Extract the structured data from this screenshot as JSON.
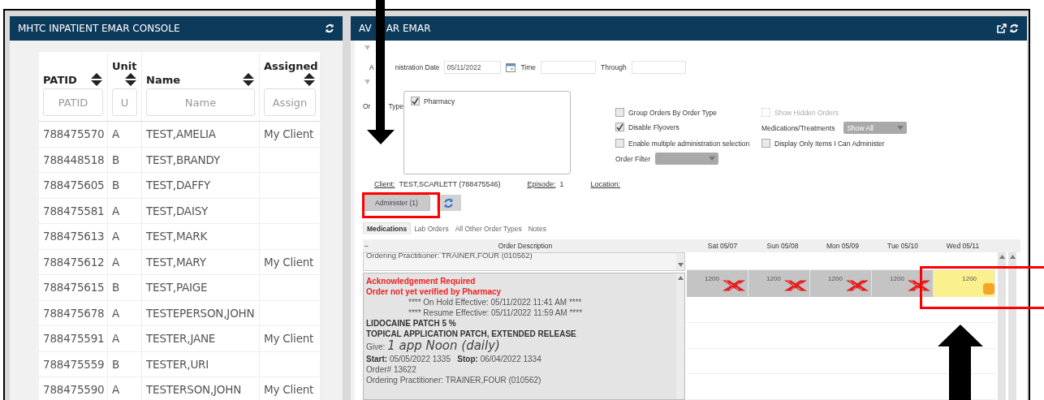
{
  "console_panel": {
    "title": "MHTC INPATIENT EMAR CONSOLE",
    "table": {
      "columns": [
        {
          "label": "PATID",
          "filter_placeholder": "PATID"
        },
        {
          "label": "Unit",
          "filter_placeholder": "U"
        },
        {
          "label": "Name",
          "filter_placeholder": "Name"
        },
        {
          "label": "Assigned",
          "filter_placeholder": "Assign"
        }
      ],
      "rows": [
        [
          "788475570",
          "A",
          "TEST,AMELIA",
          "My Client"
        ],
        [
          "788448518",
          "B",
          "TEST,BRANDY",
          ""
        ],
        [
          "788475605",
          "B",
          "TEST,DAFFY",
          ""
        ],
        [
          "788475581",
          "A",
          "TEST,DAISY",
          ""
        ],
        [
          "788475613",
          "A",
          "TEST,MARK",
          ""
        ],
        [
          "788475612",
          "A",
          "TEST,MARY",
          "My Client"
        ],
        [
          "788475615",
          "B",
          "TEST,PAIGE",
          ""
        ],
        [
          "788475678",
          "A",
          "TESTEPERSON,JOHN",
          ""
        ],
        [
          "788475591",
          "A",
          "TESTER,JANE",
          "My Client"
        ],
        [
          "788475559",
          "B",
          "TESTER,URI",
          ""
        ],
        [
          "788475590",
          "A",
          "TESTERSON,JOHN",
          "My Client"
        ]
      ]
    }
  },
  "emar_panel": {
    "title_parts": [
      "AV",
      "AR EMAR"
    ],
    "filters": {
      "date_label_parts": [
        "A",
        "nistration Date"
      ],
      "date_value": "05/11/2022",
      "time_label": "Time",
      "through_label": "Through",
      "order_type_label_parts": [
        "Or",
        "Type"
      ],
      "order_types": [
        {
          "label": "Pharmacy",
          "checked": true
        }
      ]
    },
    "options": [
      {
        "kind": "checkbox",
        "label": "Group Orders By Order Type",
        "checked": false,
        "disabled": false
      },
      {
        "kind": "checkbox",
        "label": "Show Hidden Orders",
        "checked": false,
        "disabled": true
      },
      {
        "kind": "checkbox",
        "label": "Disable Flyovers",
        "checked": true,
        "disabled": false
      },
      {
        "kind": "dropdown",
        "label": "Medications/Treatments",
        "value": "Show All"
      },
      {
        "kind": "checkbox",
        "label": "Enable multiple administration selection",
        "checked": false,
        "disabled": false
      },
      {
        "kind": "checkbox",
        "label": "Display Only Items I Can Administer",
        "checked": false,
        "disabled": false
      },
      {
        "kind": "dropdown",
        "label": "Order Filter"
      }
    ],
    "client": {
      "client_label": "Client:",
      "client_value": "TEST,SCARLETT (788475546)",
      "episode_label": "Episode:",
      "episode_value": "1",
      "location_label": "Location:"
    },
    "administer_button": "Administer (1)",
    "tabs": [
      {
        "label": "Medications",
        "selected": true
      },
      {
        "label": "Lab Orders",
        "selected": false
      },
      {
        "label": "All Other Order Types",
        "selected": false
      },
      {
        "label": "Notes",
        "selected": false
      }
    ],
    "grid": {
      "collapse_mark": "−",
      "description_header": "Order Description",
      "days": [
        "Sat  05/07",
        "Sun  05/08",
        "Mon  05/09",
        "Tue  05/10",
        "Wed  05/11"
      ],
      "previous_row_text": "Ordering Practitioner: TRAINER,FOUR (010562)",
      "order": {
        "alerts": [
          "Acknowledgement Required",
          "Order not yet verified by Pharmacy"
        ],
        "hold_lines": [
          "**** On Hold Effective: 05/11/2022 11:41 AM ****",
          "**** Resume Effective: 05/11/2022 11:59 AM ****"
        ],
        "drug_lines": [
          "LIDOCAINE PATCH 5 %",
          "TOPICAL APPLICATION PATCH, EXTENDED RELEASE"
        ],
        "give_label": "Give:",
        "give_value": "1 app Noon (daily)",
        "start_label": "Start:",
        "start_value": "05/05/2022 1335",
        "stop_label": "Stop:",
        "stop_value": "06/04/2022 1334",
        "order_number": "Order# 13622",
        "practitioner": "Ordering Practitioner: TRAINER,FOUR (010562)"
      },
      "schedule": [
        {
          "time": "1200",
          "kind": "missed"
        },
        {
          "time": "1200",
          "kind": "missed"
        },
        {
          "time": "1200",
          "kind": "missed"
        },
        {
          "time": "1200",
          "kind": "missed"
        },
        {
          "time": "1200",
          "kind": "due"
        }
      ]
    }
  }
}
